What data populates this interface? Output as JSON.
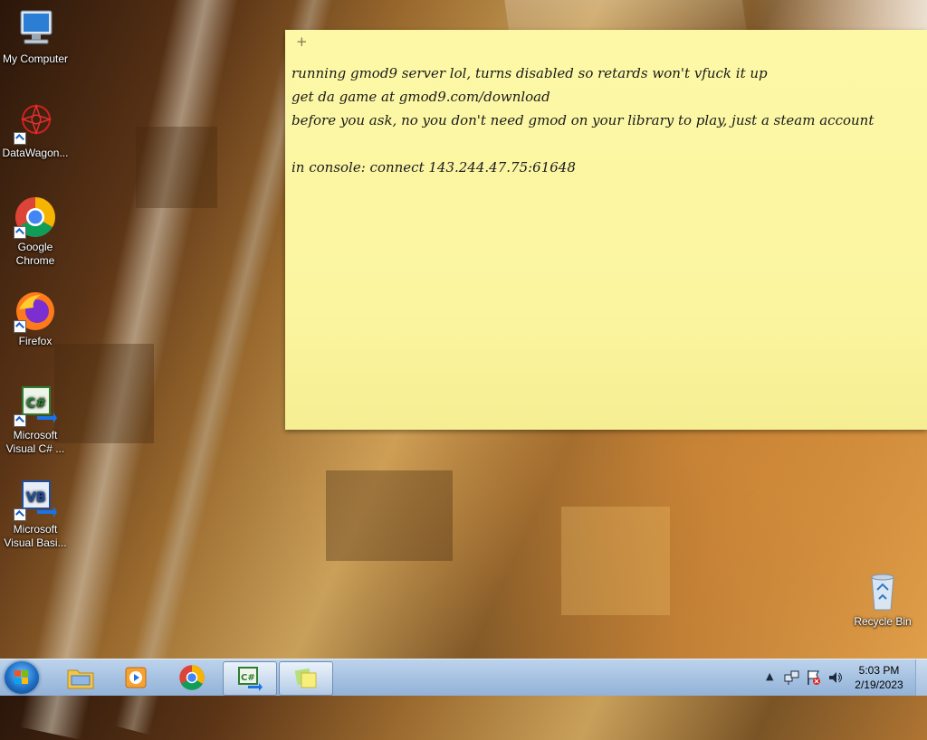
{
  "desktop_icons": [
    {
      "id": "my-computer",
      "label": "My Computer",
      "icon": "computer-icon"
    },
    {
      "id": "datawagon",
      "label": "DataWagon...",
      "icon": "datawagon-icon"
    },
    {
      "id": "chrome",
      "label": "Google Chrome",
      "icon": "chrome-icon"
    },
    {
      "id": "firefox",
      "label": "Firefox",
      "icon": "firefox-icon"
    },
    {
      "id": "vcsharp",
      "label": "Microsoft Visual C# ...",
      "icon": "visual-csharp-icon"
    },
    {
      "id": "vbasic",
      "label": "Microsoft Visual Basi...",
      "icon": "visual-basic-icon"
    },
    {
      "id": "recycle-bin",
      "label": "Recycle Bin",
      "icon": "recycle-bin-icon"
    }
  ],
  "sticky_note": {
    "add_button": "+",
    "lines": [
      "running gmod9 server lol, turns disabled so retards won't vfuck it up",
      "get da game at gmod9.com/download",
      "before you ask, no you don't need gmod on your library to play, just a steam account",
      "",
      "in console: connect 143.244.47.75:61648"
    ]
  },
  "taskbar": {
    "items": [
      {
        "id": "explorer",
        "icon": "folder-icon",
        "active": false
      },
      {
        "id": "media-player",
        "icon": "media-player-icon",
        "active": false
      },
      {
        "id": "chrome",
        "icon": "chrome-icon",
        "active": false
      },
      {
        "id": "visual-csharp",
        "icon": "visual-csharp-icon",
        "active": true
      },
      {
        "id": "sticky-notes",
        "icon": "sticky-notes-icon",
        "active": true
      }
    ],
    "tray_icons": [
      "show-hidden-icons-arrow",
      "network-icon",
      "action-center-icon",
      "volume-icon"
    ],
    "clock": {
      "time": "5:03 PM",
      "date": "2/19/2023"
    }
  },
  "colors": {
    "sticky_bg": "#fbf5a0",
    "taskbar_bg": "#a9c4e3"
  }
}
